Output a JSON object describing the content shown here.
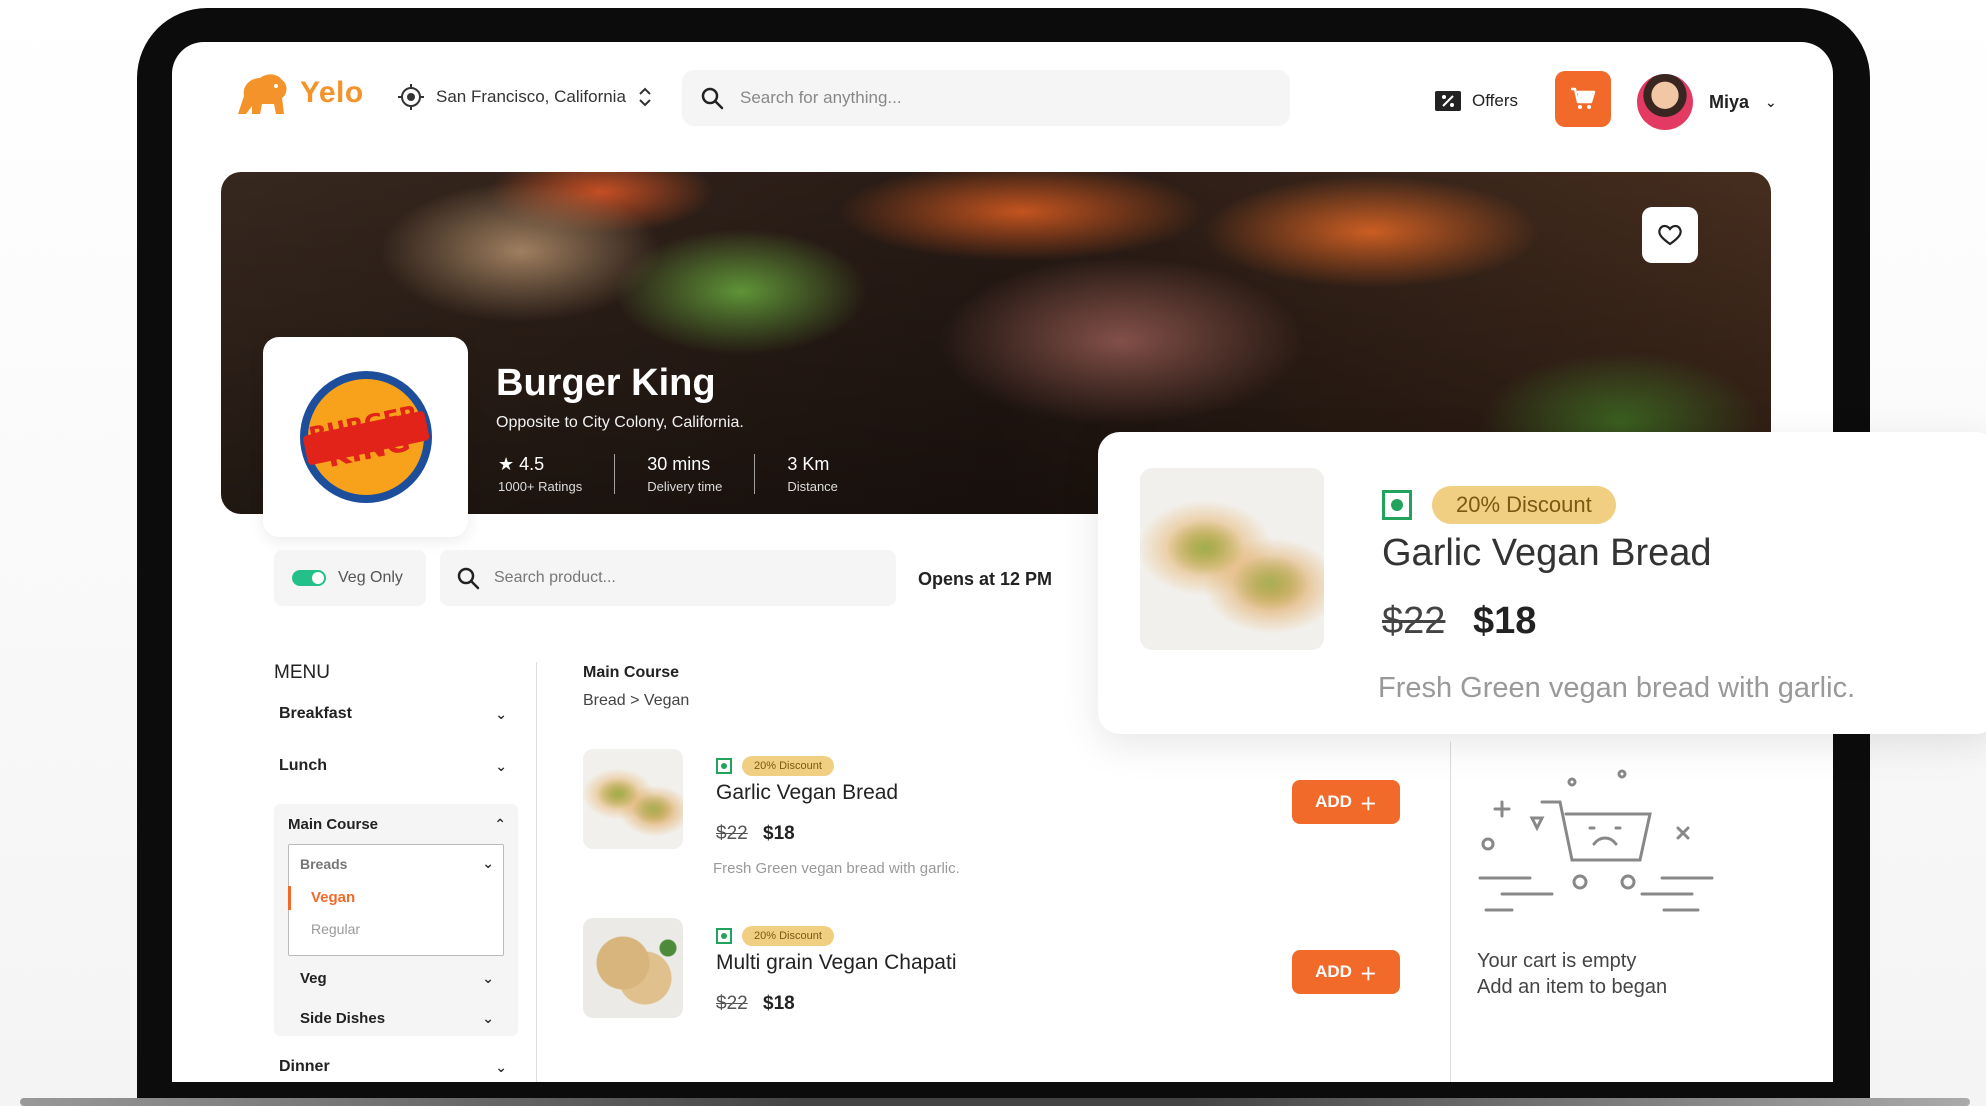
{
  "app": {
    "name": "Yelo"
  },
  "header": {
    "location": "San Francisco, California",
    "search_placeholder": "Search for anything...",
    "offers_label": "Offers",
    "user_name": "Miya"
  },
  "restaurant": {
    "name": "Burger King",
    "logo_text": "BURGER KING",
    "address": "Opposite to City Colony, California.",
    "rating": "4.5",
    "rating_label": "1000+ Ratings",
    "delivery_time": "30 mins",
    "delivery_label": "Delivery time",
    "distance": "3 Km",
    "distance_label": "Distance"
  },
  "filters": {
    "veg_only_label": "Veg Only",
    "veg_only_on": true,
    "search_placeholder": "Search product...",
    "opens_text": "Opens at 12 PM"
  },
  "menu": {
    "title": "MENU",
    "breakfast": "Breakfast",
    "lunch": "Lunch",
    "main_course": "Main Course",
    "breads": "Breads",
    "vegan": "Vegan",
    "regular": "Regular",
    "veg": "Veg",
    "side_dishes": "Side Dishes",
    "dinner": "Dinner"
  },
  "listing": {
    "title": "Main Course",
    "breadcrumb": "Bread > Vegan",
    "products": [
      {
        "name": "Garlic Vegan Bread",
        "discount": "20% Discount",
        "old_price": "$22",
        "new_price": "$18",
        "description": "Fresh Green vegan bread with garlic.",
        "add_label": "ADD"
      },
      {
        "name": "Multi grain Vegan Chapati",
        "discount": "20% Discount",
        "old_price": "$22",
        "new_price": "$18",
        "add_label": "ADD"
      }
    ]
  },
  "cart": {
    "empty_line1": "Your cart is empty",
    "empty_line2": "Add an item to began"
  },
  "featured": {
    "discount": "20% Discount",
    "name": "Garlic Vegan Bread",
    "old_price": "$22",
    "new_price": "$18",
    "description": "Fresh Green vegan bread with garlic."
  },
  "colors": {
    "accent": "#f26a2a",
    "brand": "#f4932a",
    "veg_green": "#21a35c",
    "discount_bg": "#f0cf82"
  },
  "icons": {
    "location": "crosshair-icon",
    "search": "search-icon",
    "offers": "discount-tag-icon",
    "cart": "cart-icon",
    "favorite": "heart-icon",
    "star": "star-icon"
  }
}
